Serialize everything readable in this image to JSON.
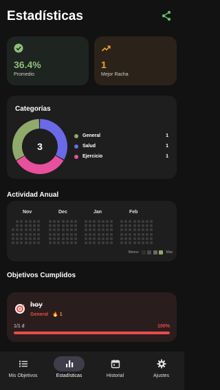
{
  "header": {
    "title": "Estadísticas",
    "share_icon": "share-icon"
  },
  "stats": [
    {
      "value": "36.4%",
      "label": "Promedio",
      "icon": "check-circle-icon",
      "color": "#8fbf7a"
    },
    {
      "value": "1",
      "label": "Mejor Racha",
      "icon": "trending-up-icon",
      "color": "#f0a030"
    }
  ],
  "categories": {
    "title": "Categorías",
    "total": "3",
    "items": [
      {
        "name": "General",
        "count": "1",
        "color": "#8faa6a"
      },
      {
        "name": "Salud",
        "count": "1",
        "color": "#6a6ae8"
      },
      {
        "name": "Ejercicio",
        "count": "1",
        "color": "#e84f9c"
      }
    ]
  },
  "activity": {
    "title": "Actividad Anual",
    "months": [
      "Nov",
      "Dec",
      "Jan",
      "Feb"
    ],
    "legend_less": "Menos",
    "legend_more": "Más",
    "legend_colors": [
      "#2f2f2f",
      "#4a4a4a",
      "#6a6a6a",
      "#8faa6a"
    ]
  },
  "goals": {
    "title": "Objetivos Cumplidos",
    "items": [
      {
        "name": "hoy",
        "category": "General",
        "streak": "1",
        "progress_label": "1/1 d",
        "percent": "100%",
        "progress": 1.0
      }
    ]
  },
  "nav": {
    "items": [
      {
        "label": "Mis Objetivos",
        "icon": "list-icon",
        "active": false
      },
      {
        "label": "Estadísticas",
        "icon": "bar-chart-icon",
        "active": true
      },
      {
        "label": "Historial",
        "icon": "calendar-icon",
        "active": false
      },
      {
        "label": "Ajustes",
        "icon": "gear-icon",
        "active": false
      }
    ]
  }
}
